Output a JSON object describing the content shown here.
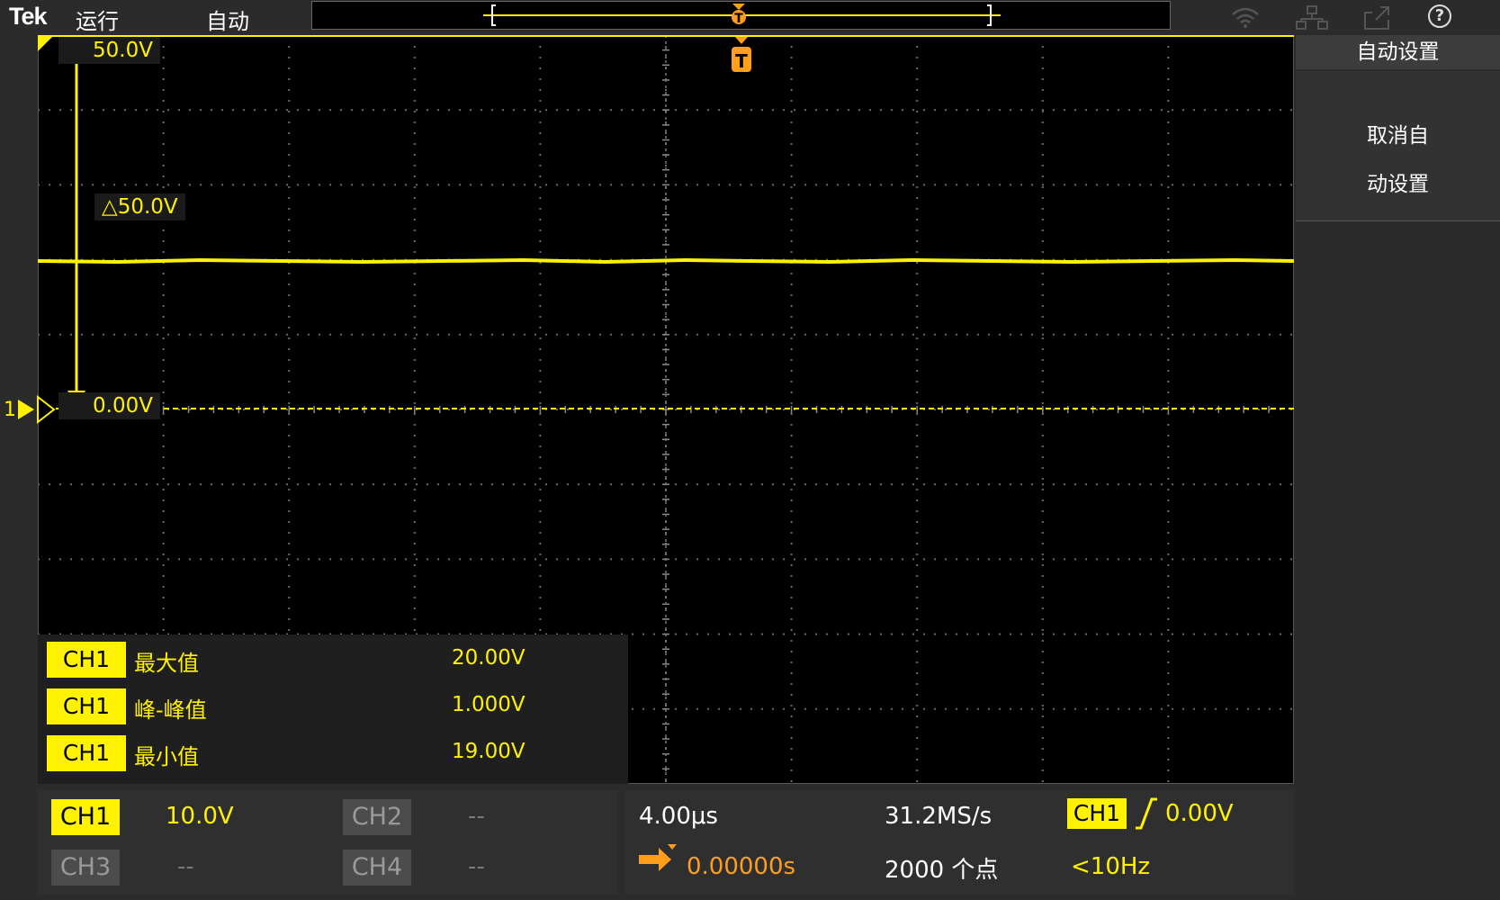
{
  "topbar": {
    "logo": "Tek",
    "run_state": "运行",
    "acq_mode": "自动",
    "icons": [
      "wifi-icon",
      "network-icon",
      "export-icon",
      "help-icon"
    ],
    "help_glyph": "?"
  },
  "plot": {
    "top_ref_label": "50.0V",
    "delta_label": "△50.0V",
    "zero_label": "0.00V",
    "channel_marker": "1",
    "trigger_marker": "T"
  },
  "side_panel": {
    "title": "自动设置",
    "undo_line1": "取消自",
    "undo_line2": "动设置"
  },
  "measurements": [
    {
      "channel": "CH1",
      "name": "最大值",
      "value": "20.00V"
    },
    {
      "channel": "CH1",
      "name": "峰-峰值",
      "value": "1.000V"
    },
    {
      "channel": "CH1",
      "name": "最小值",
      "value": "19.00V"
    }
  ],
  "channels": {
    "ch1": {
      "label": "CH1",
      "scale": "10.0V"
    },
    "ch2": {
      "label": "CH2",
      "scale": "--"
    },
    "ch3": {
      "label": "CH3",
      "scale": "--"
    },
    "ch4": {
      "label": "CH4",
      "scale": "--"
    }
  },
  "horizontal": {
    "time_per_div": "4.00μs",
    "sample_rate": "31.2MS/s",
    "position": "0.00000s",
    "record_length": "2000 个点"
  },
  "trigger": {
    "source": "CH1",
    "level": "0.00V",
    "frequency": "<10Hz"
  },
  "colors": {
    "ch1": "#fff200",
    "trigger": "#ff9e1b",
    "background": "#000000"
  }
}
